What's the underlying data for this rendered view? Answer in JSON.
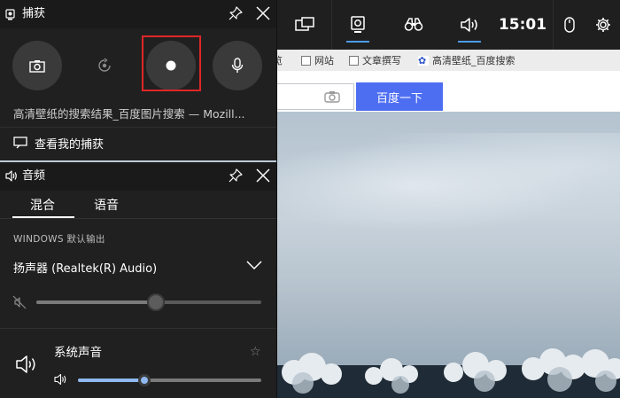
{
  "gamebar": {
    "time": "15:01",
    "active_colors": {
      "indicator": "#4c9be8"
    }
  },
  "browser": {
    "bookmarks": [
      {
        "label": "览"
      },
      {
        "label": "网站"
      },
      {
        "label": "文章撰写"
      },
      {
        "label": "高清壁纸_百度搜索"
      }
    ],
    "search_button_label": "百度一下",
    "accent": "#4e6ef2"
  },
  "capture": {
    "title": "捕获",
    "window_title": "高清壁纸的搜索结果_百度图片搜索 — Mozill...",
    "view_captures_label": "查看我的捕获",
    "highlight_color": "#e02626"
  },
  "audio": {
    "title": "音频",
    "tabs": [
      {
        "label": "混合"
      },
      {
        "label": "语音"
      }
    ],
    "active_tab": "混合",
    "output_label": "WINDOWS 默认输出",
    "device_name": "扬声器 (Realtek(R) Audio)",
    "device_volume": 0.53,
    "apps": [
      {
        "label": "系统声音",
        "volume": 0.36
      }
    ]
  }
}
